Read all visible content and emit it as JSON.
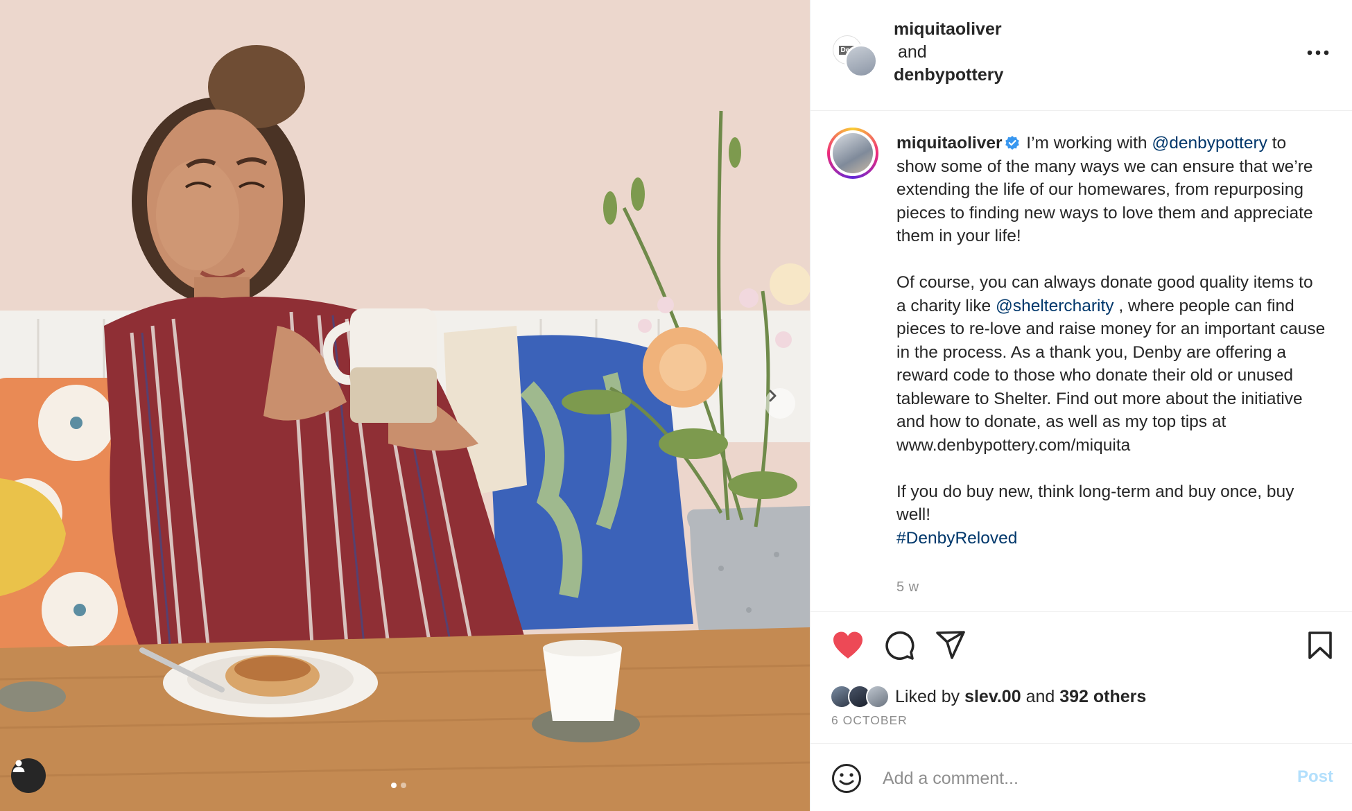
{
  "header": {
    "collab_user_1": "miquitaoliver",
    "and_text": "and",
    "collab_user_2": "denbypottery",
    "collab_badge": "Den"
  },
  "caption": {
    "username": "miquitaoliver",
    "line1_pre": " I’m working with ",
    "mention1": "@denbypottery",
    "line1_post": " to show some of the many ways we can ensure that we’re extending the life of our homewares, from repurposing pieces to finding new ways to love them and appreciate them in your life!",
    "p2_pre": "Of course, you can always donate good quality items to a charity like ",
    "mention2": "@sheltercharity",
    "p2_post": " , where people can find pieces to re-love and raise money for an important cause in the process. As a thank you, Denby are offering a reward code to those who donate their old or unused tableware to Shelter. Find out more about the initiative and how to donate, as well as my top tips at www.denbypottery.com/miquita",
    "p3": "If you do buy new, think long-term and buy once, buy well!",
    "hashtag": "#DenbyReloved",
    "time_ago": "5 w"
  },
  "likes": {
    "prefix": "Liked by ",
    "user": "slev.00",
    "middle": " and ",
    "count": "392 others",
    "date": "6 OCTOBER"
  },
  "comment": {
    "placeholder": "Add a comment...",
    "post_label": "Post"
  },
  "carousel": {
    "current": 1,
    "total": 2
  },
  "colors": {
    "like_red": "#ed4956",
    "mention_blue": "#00376b",
    "verified_blue": "#3897f0",
    "post_disabled": "#b2dffc"
  },
  "icons": {
    "like": "heart-icon",
    "comment": "comment-icon",
    "share": "paper-plane-icon",
    "save": "bookmark-icon",
    "more": "more-horizontal-icon",
    "emoji": "emoji-icon",
    "next": "chevron-right-icon",
    "tag": "user-tag-icon",
    "verified": "verified-badge-icon"
  }
}
